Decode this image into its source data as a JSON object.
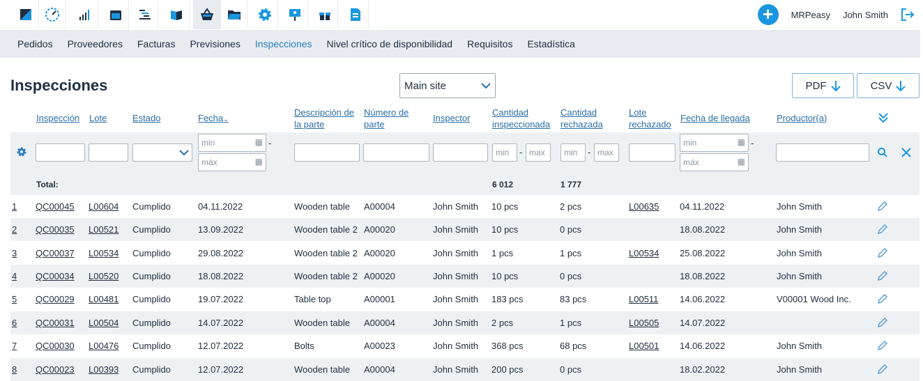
{
  "topbar": {
    "apps": [
      "logo-icon",
      "dashboard-icon",
      "chart-icon",
      "calendar-icon",
      "gantt-icon",
      "book-icon",
      "basket-icon",
      "folder-icon",
      "gear-icon",
      "presentation-icon",
      "gift-icon",
      "document-icon"
    ],
    "company": "MRPeasy",
    "user": "John Smith"
  },
  "subnav": [
    "Pedidos",
    "Proveedores",
    "Facturas",
    "Previsiones",
    "Inspecciones",
    "Nivel crítico de disponibilidad",
    "Requisitos",
    "Estadística"
  ],
  "page": {
    "title": "Inspecciones",
    "site": "Main site",
    "pdf": "PDF",
    "csv": "CSV"
  },
  "headers": {
    "inspeccion": "Inspección",
    "lote": "Lote",
    "estado": "Estado",
    "fecha": "Fecha",
    "descripcion": [
      "Descripción de",
      "la parte"
    ],
    "numero": [
      "Número de",
      "parte"
    ],
    "inspector": "Inspector",
    "cant_insp": [
      "Cantidad",
      "inspeccionada"
    ],
    "cant_rech": [
      "Cantidad",
      "rechazada"
    ],
    "lote_rech": [
      "Lote",
      "rechazado"
    ],
    "fecha_llegada": "Fecha de llegada",
    "productor": "Productor(a)"
  },
  "filters": {
    "min": "min",
    "max": "máx",
    "max2": "max"
  },
  "total": {
    "label": "Total:",
    "inspected": "6 012",
    "rejected": "1 777"
  },
  "rows": [
    {
      "n": "1",
      "insp": "QC00045",
      "lote": "L00604",
      "estado": "Cumplido",
      "fecha": "04.11.2022",
      "desc": "Wooden table",
      "parte": "A00004",
      "inspector": "John Smith",
      "qi": "10 pcs",
      "qr": "2 pcs",
      "lr": "L00635",
      "llegada": "04.11.2022",
      "prod": "John Smith"
    },
    {
      "n": "2",
      "insp": "QC00035",
      "lote": "L00521",
      "estado": "Cumplido",
      "fecha": "13.09.2022",
      "desc": "Wooden table 2",
      "parte": "A00020",
      "inspector": "John Smith",
      "qi": "10 pcs",
      "qr": "0 pcs",
      "lr": "",
      "llegada": "18.08.2022",
      "prod": "John Smith"
    },
    {
      "n": "3",
      "insp": "QC00037",
      "lote": "L00534",
      "estado": "Cumplido",
      "fecha": "29.08.2022",
      "desc": "Wooden table 2",
      "parte": "A00020",
      "inspector": "John Smith",
      "qi": "1 pcs",
      "qr": "1 pcs",
      "lr": "L00534",
      "llegada": "25.08.2022",
      "prod": "John Smith"
    },
    {
      "n": "4",
      "insp": "QC00034",
      "lote": "L00520",
      "estado": "Cumplido",
      "fecha": "18.08.2022",
      "desc": "Wooden table 2",
      "parte": "A00020",
      "inspector": "John Smith",
      "qi": "10 pcs",
      "qr": "0 pcs",
      "lr": "",
      "llegada": "18.08.2022",
      "prod": "John Smith"
    },
    {
      "n": "5",
      "insp": "QC00029",
      "lote": "L00481",
      "estado": "Cumplido",
      "fecha": "19.07.2022",
      "desc": "Table top",
      "parte": "A00001",
      "inspector": "John Smith",
      "qi": "183 pcs",
      "qr": "83 pcs",
      "lr": "L00511",
      "llegada": "14.06.2022",
      "prod": "V00001 Wood Inc."
    },
    {
      "n": "6",
      "insp": "QC00031",
      "lote": "L00504",
      "estado": "Cumplido",
      "fecha": "14.07.2022",
      "desc": "Wooden table",
      "parte": "A00004",
      "inspector": "John Smith",
      "qi": "2 pcs",
      "qr": "1 pcs",
      "lr": "L00505",
      "llegada": "14.07.2022",
      "prod": ""
    },
    {
      "n": "7",
      "insp": "QC00030",
      "lote": "L00476",
      "estado": "Cumplido",
      "fecha": "12.07.2022",
      "desc": "Bolts",
      "parte": "A00023",
      "inspector": "John Smith",
      "qi": "368 pcs",
      "qr": "68 pcs",
      "lr": "L00501",
      "llegada": "14.06.2022",
      "prod": "John Smith"
    },
    {
      "n": "8",
      "insp": "QC00023",
      "lote": "L00393",
      "estado": "Cumplido",
      "fecha": "12.07.2022",
      "desc": "Wooden table",
      "parte": "A00004",
      "inspector": "John Smith",
      "qi": "200 pcs",
      "qr": "0 pcs",
      "lr": "",
      "llegada": "18.02.2022",
      "prod": "John Smith"
    }
  ],
  "colors": {
    "accent": "#1a96e0",
    "link": "#2a6ea8",
    "nav_bg": "#e8ecf1"
  }
}
